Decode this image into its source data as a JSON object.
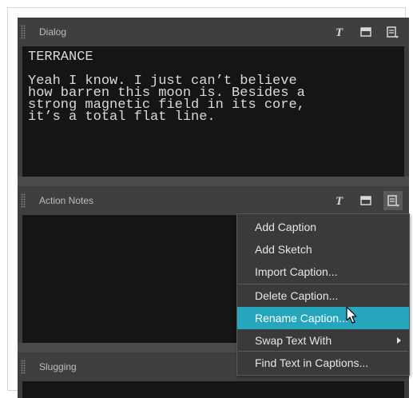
{
  "panels": {
    "dialog": {
      "title": "Dialog",
      "text": "TERRANCE\n\nYeah I know. I just can’t believe\nhow barren this moon is. Besides a\nstrong magnetic field in its core,\nit’s a total flat line."
    },
    "action_notes": {
      "title": "Action Notes",
      "text": ""
    },
    "slugging": {
      "title": "Slugging"
    }
  },
  "header_icons": [
    "text-format-icon",
    "detach-window-icon",
    "panel-menu-icon"
  ],
  "context_menu": {
    "items": [
      {
        "label": "Add Caption",
        "has_submenu": false,
        "highlighted": false
      },
      {
        "label": "Add Sketch",
        "has_submenu": false,
        "highlighted": false
      },
      {
        "label": "Import Caption...",
        "has_submenu": false,
        "highlighted": false
      },
      {
        "label": "Delete Caption...",
        "has_submenu": false,
        "highlighted": false
      },
      {
        "label": "Rename Caption...",
        "has_submenu": false,
        "highlighted": true
      },
      {
        "label": "Swap Text With",
        "has_submenu": true,
        "highlighted": false
      },
      {
        "label": "Find Text in Captions...",
        "has_submenu": false,
        "highlighted": false
      }
    ]
  },
  "colors": {
    "panel_bg": "#3c3c3c",
    "text_area_bg": "#151515",
    "menu_bg": "#3a3a3a",
    "menu_highlight": "#26a6bd"
  }
}
